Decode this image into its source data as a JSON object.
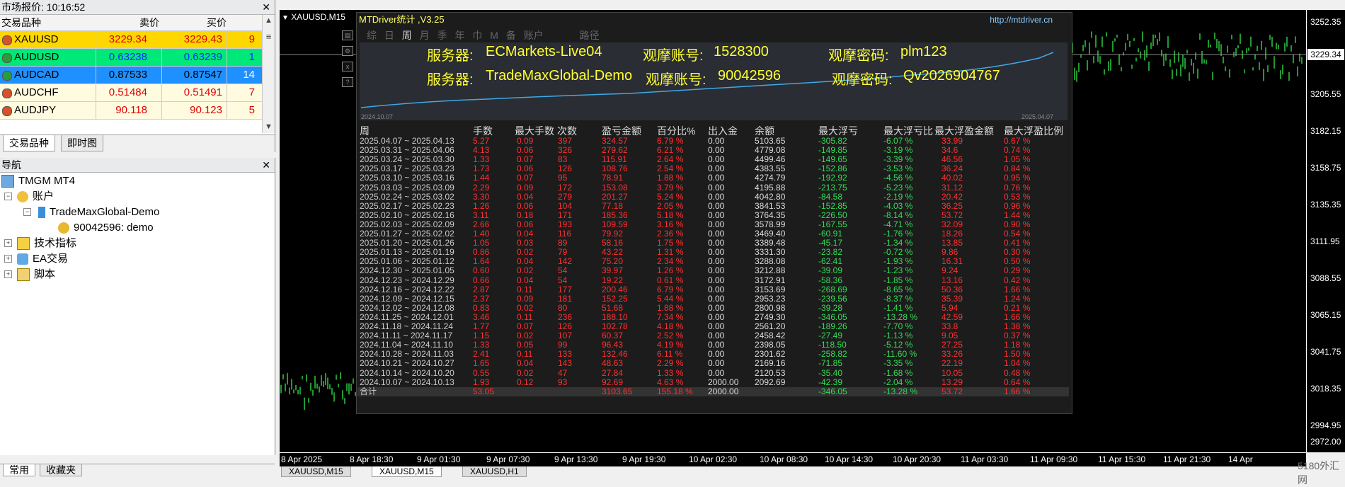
{
  "market_watch": {
    "title": "市场报价: 10:16:52",
    "columns": {
      "symbol": "交易品种",
      "bid": "卖价",
      "ask": "买价",
      "spread": ""
    },
    "rows": [
      {
        "symbol": "XAUUSD",
        "bid": "3229.34",
        "ask": "3229.43",
        "spread": "9",
        "bg": "#ffd700",
        "dir": "down"
      },
      {
        "symbol": "AUDUSD",
        "bid": "0.63238",
        "ask": "0.63239",
        "spread": "1",
        "bg": "#00e878",
        "dir": "up"
      },
      {
        "symbol": "AUDCAD",
        "bid": "0.87533",
        "ask": "0.87547",
        "spread": "14",
        "bg": "#1e90ff",
        "dir": "up"
      },
      {
        "symbol": "AUDCHF",
        "bid": "0.51484",
        "ask": "0.51491",
        "spread": "7",
        "bg": "#fffbe0",
        "dir": "down"
      },
      {
        "symbol": "AUDJPY",
        "bid": "90.118",
        "ask": "90.123",
        "spread": "5",
        "bg": "#fffbe0",
        "dir": "down"
      }
    ],
    "tabs": [
      "交易品种",
      "即时图"
    ]
  },
  "navigator": {
    "title": "导航",
    "items": [
      {
        "label": "TMGM MT4",
        "icon": "terminal-icon"
      },
      {
        "label": "账户",
        "icon": "accounts-icon"
      },
      {
        "label": "TradeMaxGlobal-Demo",
        "icon": "server-icon"
      },
      {
        "label": "90042596: demo",
        "icon": "user-icon"
      },
      {
        "label": "技术指标",
        "icon": "indicator-icon"
      },
      {
        "label": "EA交易",
        "icon": "expert-icon"
      },
      {
        "label": "脚本",
        "icon": "script-icon"
      }
    ],
    "bottom_tabs": [
      "常用",
      "收藏夹"
    ]
  },
  "chart": {
    "title": "XAUUSD,M15",
    "current_price": "3229.34",
    "price_ticks": [
      "3252.35",
      "3205.55",
      "3182.15",
      "3158.75",
      "3135.35",
      "3111.95",
      "3088.55",
      "3065.15",
      "3041.75",
      "3018.35",
      "2994.95",
      "2972.00"
    ],
    "time_ticks": [
      "8 Apr 2025",
      "8 Apr 18:30",
      "9 Apr 01:30",
      "9 Apr 07:30",
      "9 Apr 13:30",
      "9 Apr 19:30",
      "10 Apr 02:30",
      "10 Apr 08:30",
      "10 Apr 14:30",
      "10 Apr 20:30",
      "11 Apr 03:30",
      "11 Apr 09:30",
      "11 Apr 15:30",
      "11 Apr 21:30",
      "14 Apr"
    ],
    "tabs": [
      "XAUUSD,M15",
      "XAUUSD,M15",
      "XAUUSD,H1"
    ]
  },
  "mtdriver": {
    "name": "MTDriver统计 ,V3.25",
    "url": "http://mtdriver.cn",
    "tabs": [
      "综",
      "日",
      "周",
      "月",
      "季",
      "年",
      "巾",
      "M",
      "备",
      "账户",
      "",
      "路径"
    ],
    "info_line1": {
      "server_label": "服务器:",
      "server": "ECMarkets-Live04",
      "acct_label": "观摩账号:",
      "acct": "1528300",
      "pwd_label": "观摩密码:",
      "pwd": "plm123"
    },
    "info_line2": {
      "server_label": "服务器:",
      "server": "TradeMaxGlobal-Demo",
      "acct_label": "观摩账号:",
      "acct": "90042596",
      "pwd_label": "观摩密码:",
      "pwd": "Qv2026904767"
    },
    "graph_start": "2024.10.07",
    "graph_end": "2025.04.07",
    "headers": [
      "周",
      "手数",
      "最大手数",
      "次数",
      "盈亏金额",
      "百分比%",
      "出入金",
      "余额",
      "最大浮亏",
      "最大浮亏比",
      "最大浮盈金额",
      "最大浮盈比例"
    ],
    "rows": [
      [
        "2025.04.07 ~ 2025.04.13",
        "5.27",
        "0.09",
        "397",
        "324.57",
        "6.79 %",
        "0.00",
        "5103.65",
        "-305.82",
        "-6.07 %",
        "33.99",
        "0.67 %"
      ],
      [
        "2025.03.31 ~ 2025.04.06",
        "4.13",
        "0.06",
        "326",
        "279.62",
        "6.21 %",
        "0.00",
        "4779.08",
        "-149.85",
        "-3.19 %",
        "34.6",
        "0.74 %"
      ],
      [
        "2025.03.24 ~ 2025.03.30",
        "1.33",
        "0.07",
        "83",
        "115.91",
        "2.64 %",
        "0.00",
        "4499.46",
        "-149.65",
        "-3.39 %",
        "46.56",
        "1.05 %"
      ],
      [
        "2025.03.17 ~ 2025.03.23",
        "1.73",
        "0.06",
        "126",
        "108.76",
        "2.54 %",
        "0.00",
        "4383.55",
        "-152.86",
        "-3.53 %",
        "36.24",
        "0.84 %"
      ],
      [
        "2025.03.10 ~ 2025.03.16",
        "1.44",
        "0.07",
        "95",
        "78.91",
        "1.88 %",
        "0.00",
        "4274.79",
        "-192.92",
        "-4.56 %",
        "40.02",
        "0.95 %"
      ],
      [
        "2025.03.03 ~ 2025.03.09",
        "2.29",
        "0.09",
        "172",
        "153.08",
        "3.79 %",
        "0.00",
        "4195.88",
        "-213.75",
        "-5.23 %",
        "31.12",
        "0.76 %"
      ],
      [
        "2025.02.24 ~ 2025.03.02",
        "3.30",
        "0.04",
        "279",
        "201.27",
        "5.24 %",
        "0.00",
        "4042.80",
        "-84.58",
        "-2.19 %",
        "20.42",
        "0.53 %"
      ],
      [
        "2025.02.17 ~ 2025.02.23",
        "1.26",
        "0.06",
        "104",
        "77.18",
        "2.05 %",
        "0.00",
        "3841.53",
        "-152.85",
        "-4.03 %",
        "36.25",
        "0.96 %"
      ],
      [
        "2025.02.10 ~ 2025.02.16",
        "3.11",
        "0.18",
        "171",
        "185.36",
        "5.18 %",
        "0.00",
        "3764.35",
        "-226.50",
        "-8.14 %",
        "53.72",
        "1.44 %"
      ],
      [
        "2025.02.03 ~ 2025.02.09",
        "2.66",
        "0.06",
        "193",
        "109.59",
        "3.16 %",
        "0.00",
        "3578.99",
        "-167.55",
        "-4.71 %",
        "32.09",
        "0.90 %"
      ],
      [
        "2025.01.27 ~ 2025.02.02",
        "1.40",
        "0.04",
        "116",
        "79.92",
        "2.36 %",
        "0.00",
        "3469.40",
        "-60.91",
        "-1.76 %",
        "18.26",
        "0.54 %"
      ],
      [
        "2025.01.20 ~ 2025.01.26",
        "1.05",
        "0.03",
        "89",
        "58.16",
        "1.75 %",
        "0.00",
        "3389.48",
        "-45.17",
        "-1.34 %",
        "13.85",
        "0.41 %"
      ],
      [
        "2025.01.13 ~ 2025.01.19",
        "0.86",
        "0.02",
        "79",
        "43.22",
        "1.31 %",
        "0.00",
        "3331.30",
        "-23.82",
        "-0.72 %",
        "9.86",
        "0.30 %"
      ],
      [
        "2025.01.06 ~ 2025.01.12",
        "1.64",
        "0.04",
        "142",
        "75.20",
        "2.34 %",
        "0.00",
        "3288.08",
        "-62.41",
        "-1.93 %",
        "16.31",
        "0.50 %"
      ],
      [
        "2024.12.30 ~ 2025.01.05",
        "0.60",
        "0.02",
        "54",
        "39.97",
        "1.26 %",
        "0.00",
        "3212.88",
        "-39.09",
        "-1.23 %",
        "9.24",
        "0.29 %"
      ],
      [
        "2024.12.23 ~ 2024.12.29",
        "0.66",
        "0.04",
        "54",
        "19.22",
        "0.61 %",
        "0.00",
        "3172.91",
        "-58.36",
        "-1.85 %",
        "13.16",
        "0.42 %"
      ],
      [
        "2024.12.16 ~ 2024.12.22",
        "2.87",
        "0.11",
        "177",
        "200.46",
        "6.79 %",
        "0.00",
        "3153.69",
        "-268.69",
        "-8.65 %",
        "50.36",
        "1.66 %"
      ],
      [
        "2024.12.09 ~ 2024.12.15",
        "2.37",
        "0.09",
        "181",
        "152.25",
        "5.44 %",
        "0.00",
        "2953.23",
        "-239.56",
        "-8.37 %",
        "35.39",
        "1.24 %"
      ],
      [
        "2024.12.02 ~ 2024.12.08",
        "0.83",
        "0.02",
        "80",
        "51.68",
        "1.88 %",
        "0.00",
        "2800.98",
        "-39.28",
        "-1.41 %",
        "5.94",
        "0.21 %"
      ],
      [
        "2024.11.25 ~ 2024.12.01",
        "3.46",
        "0.11",
        "236",
        "188.10",
        "7.34 %",
        "0.00",
        "2749.30",
        "-346.05",
        "-13.28 %",
        "42.59",
        "1.66 %"
      ],
      [
        "2024.11.18 ~ 2024.11.24",
        "1.77",
        "0.07",
        "126",
        "102.78",
        "4.18 %",
        "0.00",
        "2561.20",
        "-189.26",
        "-7.70 %",
        "33.8",
        "1.38 %"
      ],
      [
        "2024.11.11 ~ 2024.11.17",
        "1.15",
        "0.02",
        "107",
        "60.37",
        "2.52 %",
        "0.00",
        "2458.42",
        "-27.49",
        "-1.13 %",
        "9.05",
        "0.37 %"
      ],
      [
        "2024.11.04 ~ 2024.11.10",
        "1.33",
        "0.05",
        "99",
        "96.43",
        "4.19 %",
        "0.00",
        "2398.05",
        "-118.50",
        "-5.12 %",
        "27.25",
        "1.18 %"
      ],
      [
        "2024.10.28 ~ 2024.11.03",
        "2.41",
        "0.11",
        "133",
        "132.46",
        "6.11 %",
        "0.00",
        "2301.62",
        "-258.82",
        "-11.60 %",
        "33.26",
        "1.50 %"
      ],
      [
        "2024.10.21 ~ 2024.10.27",
        "1.65",
        "0.04",
        "143",
        "48.63",
        "2.29 %",
        "0.00",
        "2169.16",
        "-71.85",
        "-3.35 %",
        "22.19",
        "1.04 %"
      ],
      [
        "2024.10.14 ~ 2024.10.20",
        "0.55",
        "0.02",
        "47",
        "27.84",
        "1.33 %",
        "0.00",
        "2120.53",
        "-35.40",
        "-1.68 %",
        "10.05",
        "0.48 %"
      ],
      [
        "2024.10.07 ~ 2024.10.13",
        "1.93",
        "0.12",
        "93",
        "92.69",
        "4.63 %",
        "2000.00",
        "2092.69",
        "-42.39",
        "-2.04 %",
        "13.29",
        "0.64 %"
      ]
    ],
    "total": [
      "合计",
      "53.05",
      "",
      "",
      "3103.65",
      "155.18 %",
      "2000.00",
      "",
      "-346.05",
      "-13.28 %",
      "53.72",
      "1.66 %"
    ]
  },
  "watermark": "5180外汇网"
}
